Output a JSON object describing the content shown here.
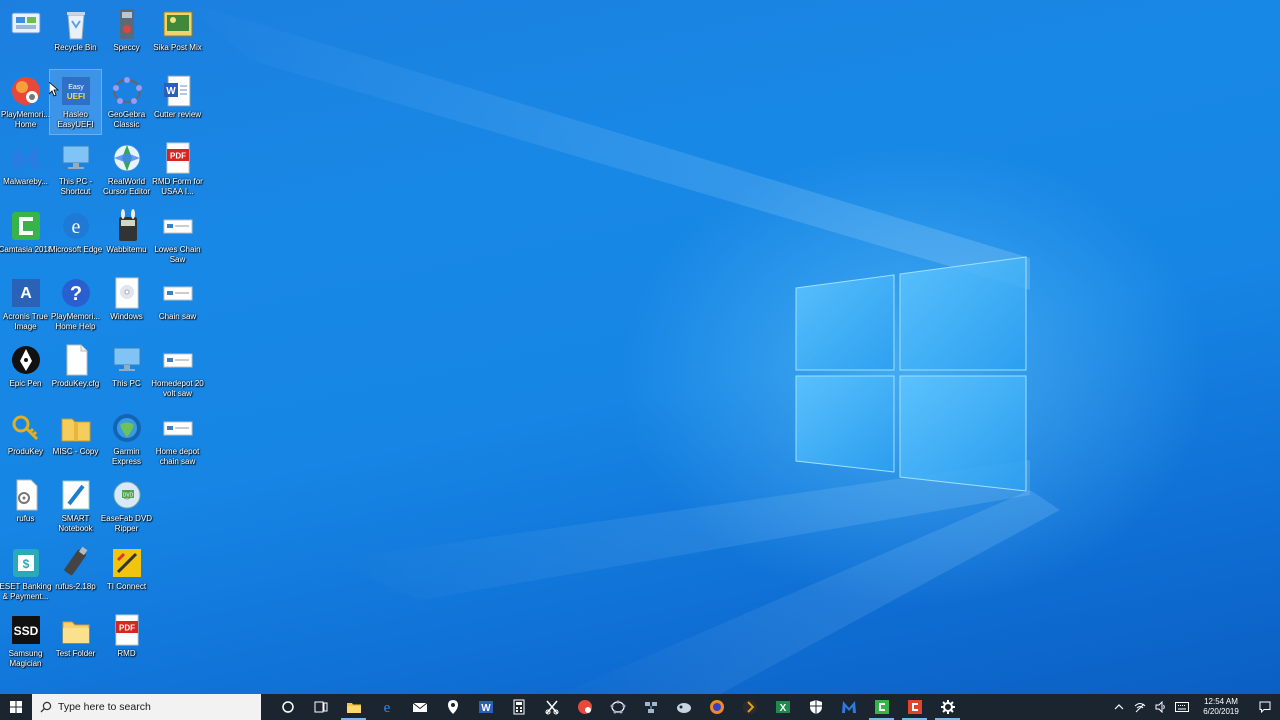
{
  "desktop": {
    "icons": [
      {
        "label": "",
        "icon": "control-panel-icon"
      },
      {
        "label": "Recycle Bin",
        "icon": "recycle-bin-icon"
      },
      {
        "label": "Speccy",
        "icon": "speccy-icon"
      },
      {
        "label": "Sika Post Mix",
        "icon": "image-file-icon"
      },
      {
        "label": "PlayMemori... Home",
        "icon": "playmemories-icon"
      },
      {
        "label": "Hasleo EasyUEFI",
        "icon": "easyuefi-icon"
      },
      {
        "label": "GeoGebra Classic",
        "icon": "geogebra-icon"
      },
      {
        "label": "Cutter review",
        "icon": "word-document-icon"
      },
      {
        "label": "Malwareby...",
        "icon": "malwarebytes-icon"
      },
      {
        "label": "This PC - Shortcut",
        "icon": "this-pc-icon"
      },
      {
        "label": "RealWorld Cursor Editor",
        "icon": "cursor-editor-icon"
      },
      {
        "label": "RMD Form for USAA I...",
        "icon": "pdf-file-icon"
      },
      {
        "label": "Camtasia 2018",
        "icon": "camtasia-icon"
      },
      {
        "label": "Microsoft Edge",
        "icon": "edge-icon"
      },
      {
        "label": "Wabbitemu",
        "icon": "wabbitemu-icon"
      },
      {
        "label": "Lowes Chain Saw",
        "icon": "web-shortcut-icon"
      },
      {
        "label": "Acronis True Image",
        "icon": "acronis-icon"
      },
      {
        "label": "PlayMemori... Home Help",
        "icon": "help-icon"
      },
      {
        "label": "Windows",
        "icon": "disc-icon"
      },
      {
        "label": "Chain saw",
        "icon": "web-shortcut-icon"
      },
      {
        "label": "Epic Pen",
        "icon": "epic-pen-icon"
      },
      {
        "label": "ProduKey.cfg",
        "icon": "blank-file-icon"
      },
      {
        "label": "This PC",
        "icon": "this-pc-icon"
      },
      {
        "label": "Homedepot 20 volt saw",
        "icon": "web-shortcut-icon"
      },
      {
        "label": "ProduKey",
        "icon": "produkey-icon"
      },
      {
        "label": "MISC - Copy",
        "icon": "zip-folder-icon"
      },
      {
        "label": "Garmin Express",
        "icon": "garmin-icon"
      },
      {
        "label": "Home depot chain saw",
        "icon": "web-shortcut-icon"
      },
      {
        "label": "rufus",
        "icon": "settings-file-icon"
      },
      {
        "label": "SMART Notebook",
        "icon": "smart-notebook-icon"
      },
      {
        "label": "EaseFab DVD Ripper",
        "icon": "dvd-ripper-icon"
      },
      {
        "label": "",
        "icon": ""
      },
      {
        "label": "ESET Banking & Payment...",
        "icon": "eset-icon"
      },
      {
        "label": "rufus-2.18p",
        "icon": "usb-drive-icon"
      },
      {
        "label": "TI Connect",
        "icon": "ti-connect-icon"
      },
      {
        "label": "",
        "icon": ""
      },
      {
        "label": "Samsung Magician",
        "icon": "samsung-ssd-icon"
      },
      {
        "label": "Test Folder",
        "icon": "folder-icon"
      },
      {
        "label": "RMD",
        "icon": "pdf-file-icon"
      }
    ]
  },
  "taskbar": {
    "search_placeholder": "Type here to search",
    "pinned": [
      {
        "name": "cortana-icon",
        "color": "#ffffff"
      },
      {
        "name": "task-view-icon",
        "color": "#ffffff"
      },
      {
        "name": "file-explorer-icon",
        "color": "#f4c542"
      },
      {
        "name": "edge-icon",
        "color": "#2a8ff0"
      },
      {
        "name": "mail-icon",
        "color": "#ffffff"
      },
      {
        "name": "maps-icon",
        "color": "#ffffff"
      },
      {
        "name": "word-icon",
        "color": "#2b5fb8"
      },
      {
        "name": "calculator-icon",
        "color": "#ffffff"
      },
      {
        "name": "snipping-tool-icon",
        "color": "#ffffff"
      },
      {
        "name": "playmemories-icon",
        "color": "#e84a3a"
      },
      {
        "name": "geogebra-icon",
        "color": "#ffffff"
      },
      {
        "name": "network-app-icon",
        "color": "#9fb8d0"
      },
      {
        "name": "speccy-icon",
        "color": "#c8d4e0"
      },
      {
        "name": "firefox-icon",
        "color": "#f08a24"
      },
      {
        "name": "plex-icon",
        "color": "#e5a00d"
      },
      {
        "name": "excel-icon",
        "color": "#1f8a4c"
      },
      {
        "name": "defender-icon",
        "color": "#ffffff"
      },
      {
        "name": "malwarebytes-icon",
        "color": "#2c7be5"
      },
      {
        "name": "camtasia-icon",
        "color": "#37b34a"
      },
      {
        "name": "camtasia-recorder-icon",
        "color": "#e0452c"
      },
      {
        "name": "settings-icon",
        "color": "#ffffff"
      }
    ],
    "tray": {
      "icons": [
        "chevron-up-icon",
        "wifi-icon",
        "volume-icon",
        "keyboard-icon"
      ],
      "time": "12:54 AM",
      "date": "6/20/2019"
    }
  },
  "colors": {
    "taskbar_bg": "#1b2530",
    "accent": "#76b9ed",
    "wallpaper_base": "#1685e4"
  }
}
